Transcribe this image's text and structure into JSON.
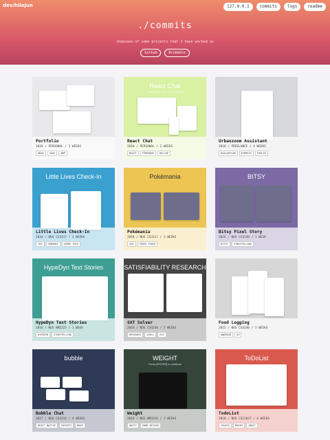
{
  "header": {
    "brand": "dev/hilejun",
    "nav": [
      "127.0.0.1",
      "commits",
      "logs",
      "readme"
    ],
    "title": "./commits",
    "subtitle": "showcase of some projects that I have worked on",
    "links": [
      "Github",
      "Dribbble"
    ]
  },
  "cards": [
    {
      "name": "Portfolio",
      "meta": "2018 / PERSONAL / 2 WEEKS",
      "tags": [
        "GRAV",
        "SASS",
        "AMP"
      ],
      "thumb_title": "",
      "thumb_sub": "",
      "bg": "#e9e9ec"
    },
    {
      "name": "React Chat",
      "meta": "2018 / PERSONAL / 2 WEEKS",
      "tags": [
        "REACT",
        "FIREBASE",
        "ROLLUP"
      ],
      "thumb_title": "React Chat",
      "thumb_sub": "Responsive Chat Environment",
      "bg": "#d8f1a3"
    },
    {
      "name": "Urbanzoom Assistant",
      "meta": "2018 / FREELANCE / 4 WEEKS",
      "tags": [
        "DIALOGFLOW",
        "EXPRESS",
        "TWILIO"
      ],
      "thumb_title": "",
      "thumb_sub": "",
      "bg": "#d6d8dc"
    },
    {
      "name": "Little Lives Check-In",
      "meta": "2018 / NUS CS3217 / 3 WEEKS",
      "tags": [
        "IOS",
        "SENSORS",
        "AZURE FACE"
      ],
      "thumb_title": "Little Lives Check-In",
      "thumb_sub": "",
      "bg": "#3aa1cf"
    },
    {
      "name": "Pokémania",
      "meta": "2018 / NUS CS3217 / 3 WEEKS",
      "tags": [
        "IOS",
        "CROSS TOUCH"
      ],
      "thumb_title": "Pokémania",
      "thumb_sub": "",
      "bg": "#ecc553"
    },
    {
      "name": "Bitsy Pixel Story",
      "meta": "2016 / NUS CS3240 / 1 WEEK",
      "tags": [
        "BITSY",
        "STORYTELLING"
      ],
      "thumb_title": "BITSY",
      "thumb_sub": "",
      "bg": "#7b6aa3"
    },
    {
      "name": "HypeDyn Text Stories",
      "meta": "2016 / NUS NM2225 / 1 WEEK",
      "tags": [
        "HYPEDYN",
        "STORYTELLING"
      ],
      "thumb_title": "HypeDyn Text Stories",
      "thumb_sub": "",
      "bg": "#3f9e93"
    },
    {
      "name": "SAT Solver",
      "meta": "2018 / NUS CS4244 / 5 WEEKS",
      "tags": [
        "RESEARCH",
        "SHELL",
        "CSS"
      ],
      "thumb_title": "SATISFIABILITY RESEARCH",
      "thumb_sub": "",
      "bg": "#444444"
    },
    {
      "name": "Food Logging",
      "meta": "2015 / NUS CS4240 / 3 WEEKS",
      "tags": [
        "ANDROID",
        "UX"
      ],
      "thumb_title": "",
      "thumb_sub": "",
      "bg": "#d7d7d7"
    },
    {
      "name": "Bubble Chat",
      "meta": "2017 / NUS CS3216 / 4 WEEKS",
      "tags": [
        "REACT NATIVE",
        "SOCKETS",
        "NODE"
      ],
      "thumb_title": "bubble",
      "thumb_sub": "",
      "bg": "#2f3a57"
    },
    {
      "name": "Weight",
      "meta": "2018 / NUS NM3216 / 3 WEEKS",
      "tags": [
        "UNITY",
        "GAME DESIGN"
      ],
      "thumb_title": "WEIGHT",
      "thumb_sub": "Press [ENTER] to continue",
      "bg": "#35453a"
    },
    {
      "name": "TodoList",
      "meta": "2018 / NUS CS2103T / 6 WEEKS",
      "tags": [
        "JAVAFX",
        "MAVEN",
        "JUNIT"
      ],
      "thumb_title": "ToDoList",
      "thumb_sub": "",
      "bg": "#d9594f"
    }
  ]
}
